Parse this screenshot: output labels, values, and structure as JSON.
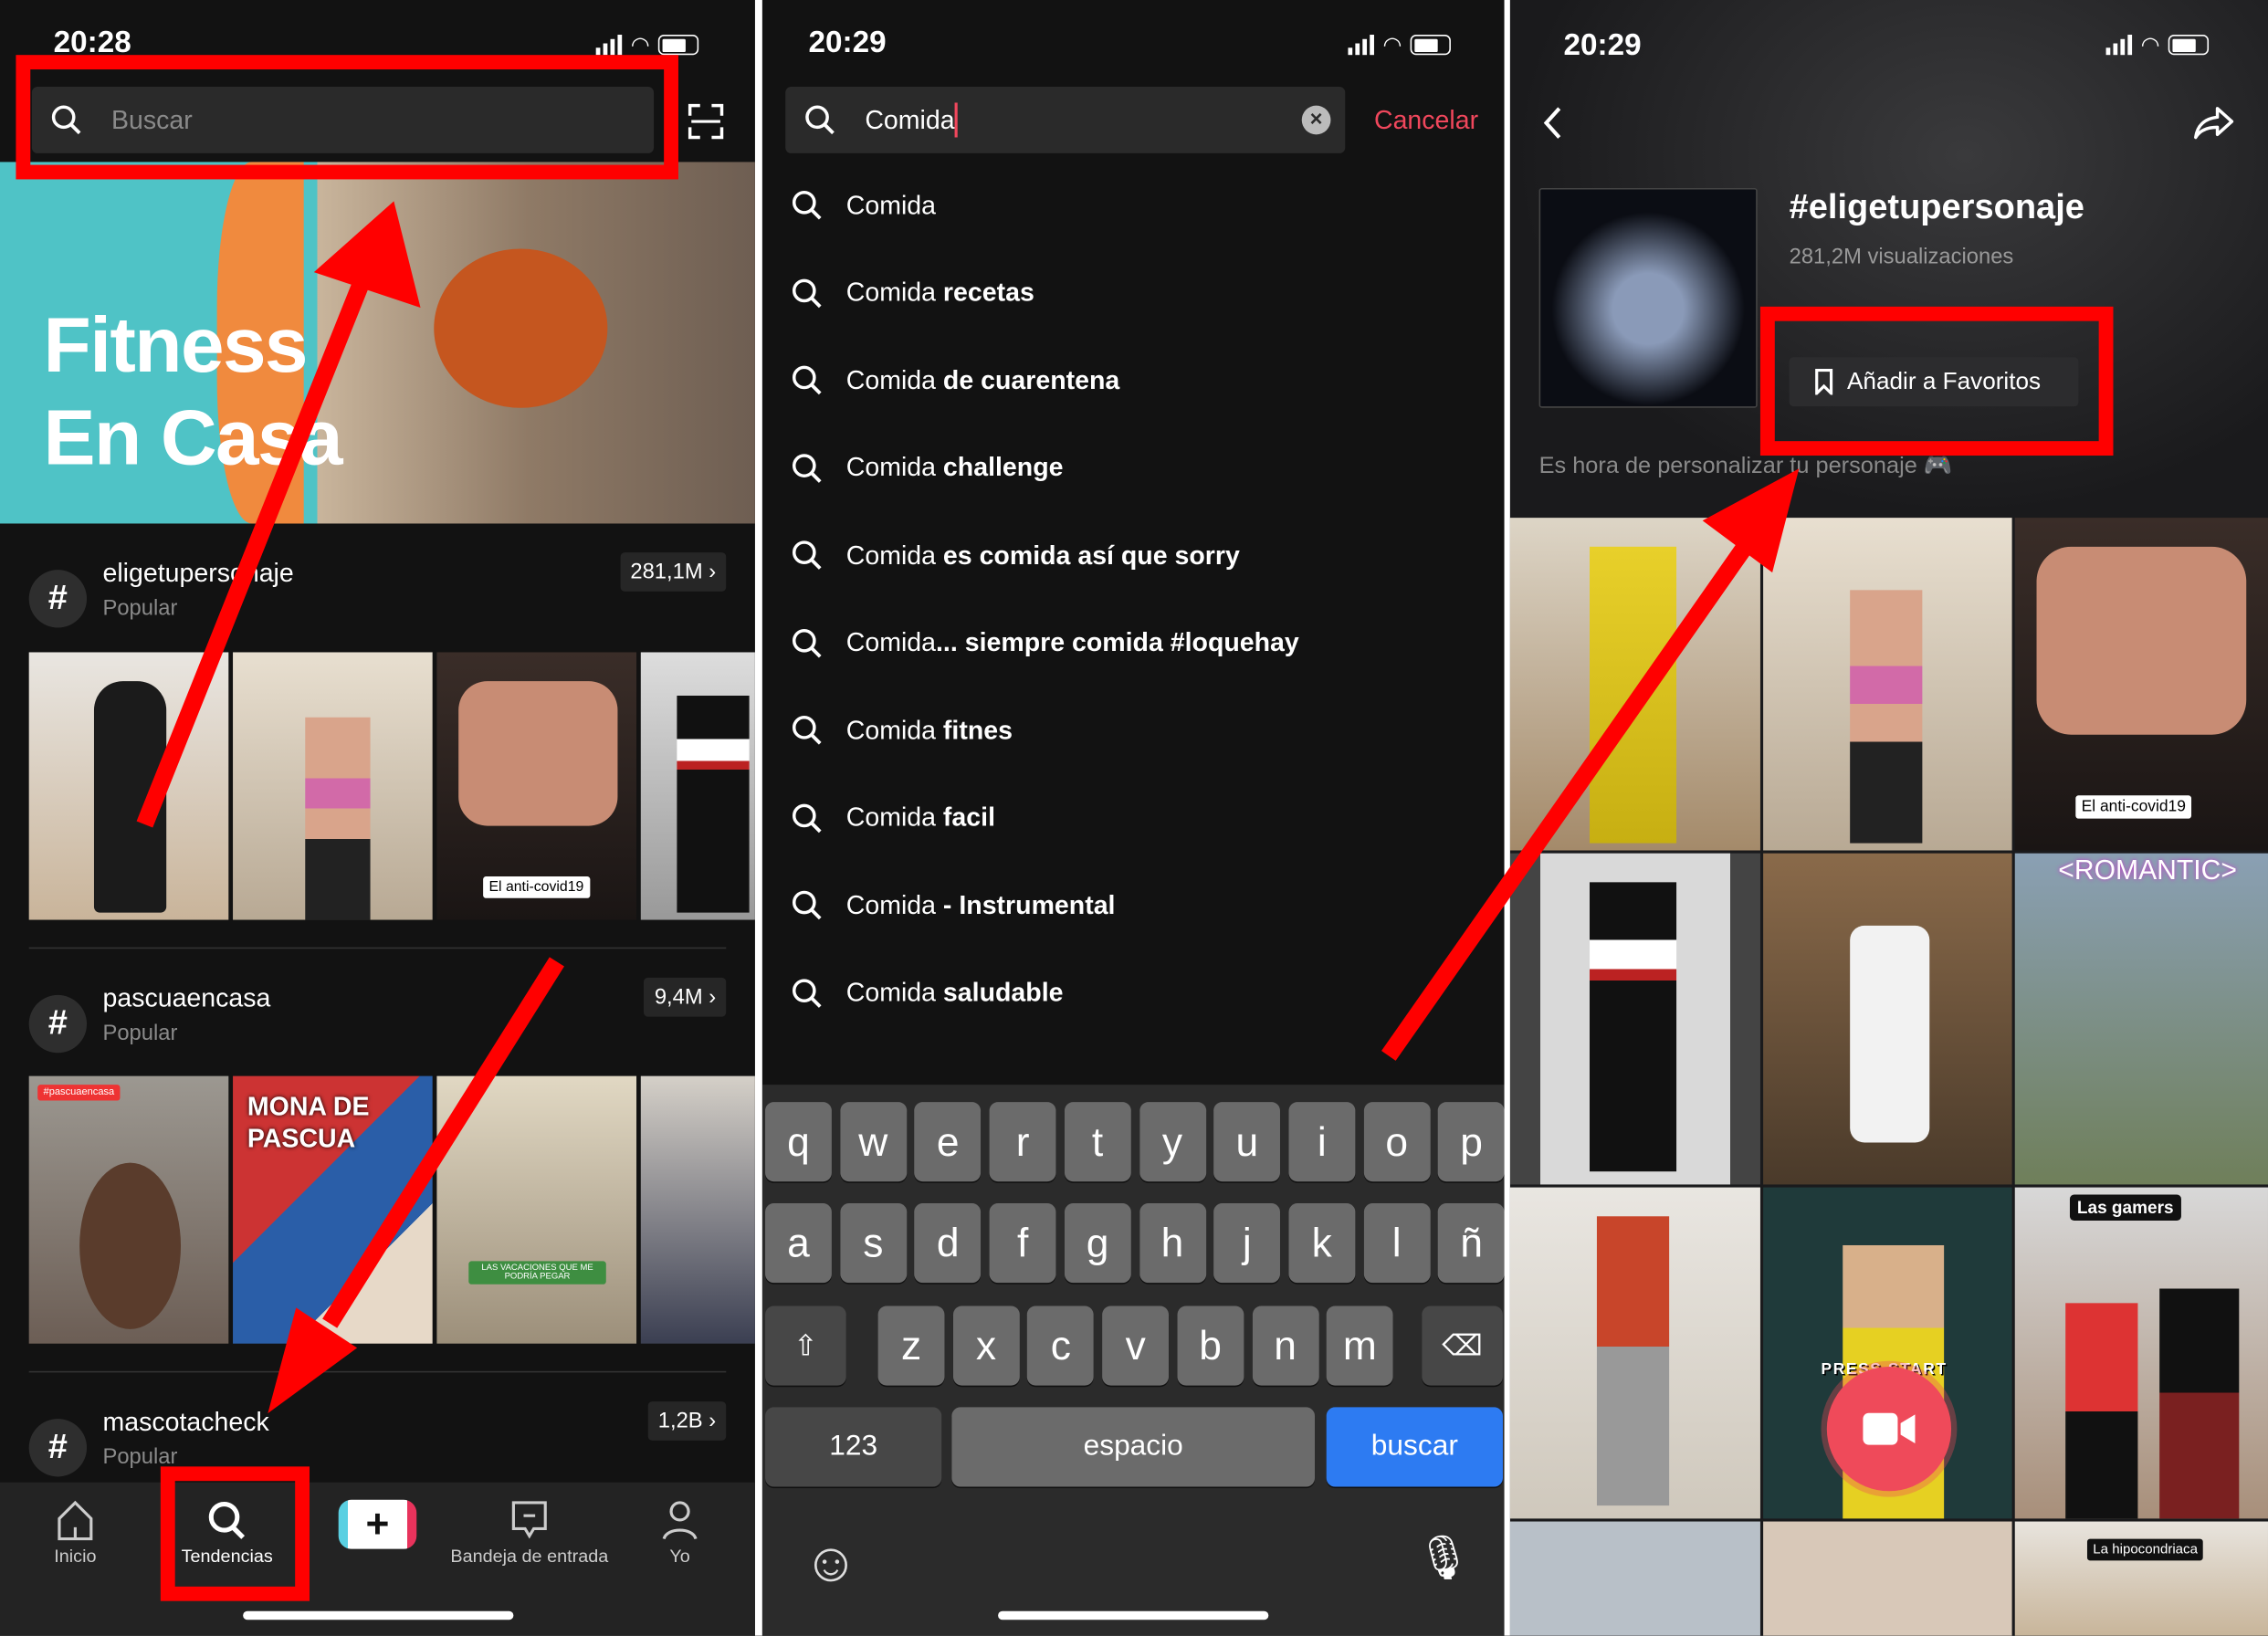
{
  "colors": {
    "annotation": "#ff0000",
    "accent_cancel": "#f0475c",
    "keyboard_action": "#2d7bf2",
    "background": "#121212"
  },
  "panel1": {
    "status": {
      "time": "20:28"
    },
    "search": {
      "placeholder": "Buscar",
      "icon": "search-icon",
      "scan_icon": "scan-icon"
    },
    "banner": {
      "line1": "Fitness",
      "line2": "En Casa"
    },
    "hashtags": [
      {
        "name": "eligetupersonaje",
        "sub": "Popular",
        "count": "281,1M ›",
        "thumb_labels": [
          "",
          "",
          "El anti-covid19",
          ""
        ]
      },
      {
        "name": "pascuaencasa",
        "sub": "Popular",
        "count": "9,4M ›",
        "thumb_labels": [
          "#pascuaencasa",
          "MONA DE PASCUA",
          "LAS VACACIONES QUE ME PODRÍA PEGAR",
          ""
        ]
      },
      {
        "name": "mascotacheck",
        "sub": "Popular",
        "count": "1,2B ›"
      }
    ],
    "tabbar": [
      {
        "label": "Inicio",
        "icon": "home-icon"
      },
      {
        "label": "Tendencias",
        "icon": "search-icon",
        "active": true
      },
      {
        "label": "",
        "icon": "plus-icon"
      },
      {
        "label": "Bandeja de entrada",
        "icon": "inbox-icon"
      },
      {
        "label": "Yo",
        "icon": "profile-icon"
      }
    ]
  },
  "panel2": {
    "status": {
      "time": "20:29"
    },
    "search": {
      "value": "Comida",
      "cancel": "Cancelar"
    },
    "suggestions": [
      {
        "prefix": "Comida",
        "bold": ""
      },
      {
        "prefix": "Comida",
        "bold": " recetas"
      },
      {
        "prefix": "Comida",
        "bold": " de cuarentena"
      },
      {
        "prefix": "Comida",
        "bold": " challenge"
      },
      {
        "prefix": "Comida",
        "bold": " es comida así que sorry"
      },
      {
        "prefix": "Comida",
        "bold": "... siempre comida #loquehay"
      },
      {
        "prefix": "Comida",
        "bold": " fitnes"
      },
      {
        "prefix": "Comida",
        "bold": " facil"
      },
      {
        "prefix": "Comida",
        "bold": " - Instrumental"
      },
      {
        "prefix": "Comida",
        "bold": " saludable"
      }
    ],
    "keyboard": {
      "row1": [
        "q",
        "w",
        "e",
        "r",
        "t",
        "y",
        "u",
        "i",
        "o",
        "p"
      ],
      "row2": [
        "a",
        "s",
        "d",
        "f",
        "g",
        "h",
        "j",
        "k",
        "l",
        "ñ"
      ],
      "row3": [
        "z",
        "x",
        "c",
        "v",
        "b",
        "n",
        "m"
      ],
      "shift": "⇧",
      "backspace": "⌫",
      "numbers": "123",
      "space": "espacio",
      "action": "buscar",
      "emoji": "☺",
      "mic": "🎙"
    }
  },
  "panel3": {
    "status": {
      "time": "20:29"
    },
    "title": "#eligetupersonaje",
    "views": "281,2M visualizaciones",
    "favorite_button": "Añadir a Favoritos",
    "description": "Es hora de personalizar tu personaje 🎮",
    "video_labels": {
      "anticovid": "El anti-covid19",
      "romantic": "<ROMANTIC>",
      "gamers": "Las gamers",
      "press_start": "PRESS START",
      "hipocondriaca": "La hipocondriaca"
    }
  }
}
